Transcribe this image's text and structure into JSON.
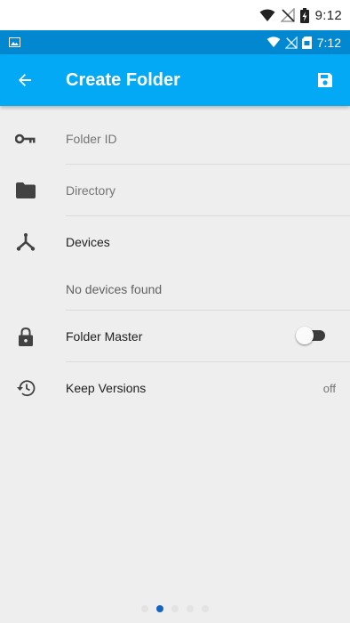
{
  "device_status": {
    "time": "9:12",
    "icons": [
      "wifi-icon",
      "no-signal-icon",
      "battery-charging-icon"
    ]
  },
  "app_status": {
    "time": "7:12",
    "icons": [
      "image-notification-icon",
      "wifi-icon",
      "no-signal-icon",
      "sd-card-icon"
    ]
  },
  "toolbar": {
    "title": "Create Folder",
    "back_icon": "arrow-back-icon",
    "save_icon": "save-icon"
  },
  "form": {
    "folder_id": {
      "placeholder": "Folder ID",
      "icon": "key-icon"
    },
    "directory": {
      "placeholder": "Directory",
      "icon": "folder-icon"
    },
    "devices": {
      "label": "Devices",
      "icon": "devices-share-icon",
      "empty_text": "No devices found"
    },
    "folder_master": {
      "label": "Folder Master",
      "icon": "lock-icon",
      "enabled": false
    },
    "keep_versions": {
      "label": "Keep Versions",
      "icon": "history-icon",
      "value": "off"
    }
  },
  "pager": {
    "count": 5,
    "active_index": 1
  },
  "colors": {
    "status_bar": "#0288d1",
    "toolbar": "#03a9f4",
    "background": "#eeeeee",
    "pager_active": "#1565c0"
  }
}
